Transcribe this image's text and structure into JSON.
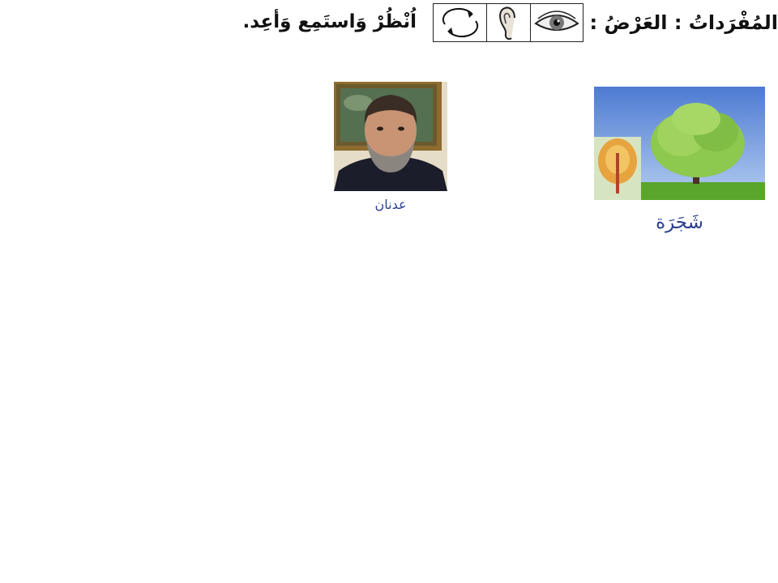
{
  "header": {
    "title": "المُفْرَداتُ : العَرْضُ :",
    "instruction": "اُنْظُرْ وَاستَمِع وَأعِد."
  },
  "icons": [
    "refresh-arrows-icon",
    "ear-icon",
    "eye-icon"
  ],
  "cards": [
    {
      "name": "tree",
      "label": "شَجَرَة"
    },
    {
      "name": "adnan",
      "label": "عدنان"
    }
  ],
  "colors": {
    "caption": "#2a3f8f",
    "sky": "#6f93d6",
    "grass": "#5aa62c"
  }
}
